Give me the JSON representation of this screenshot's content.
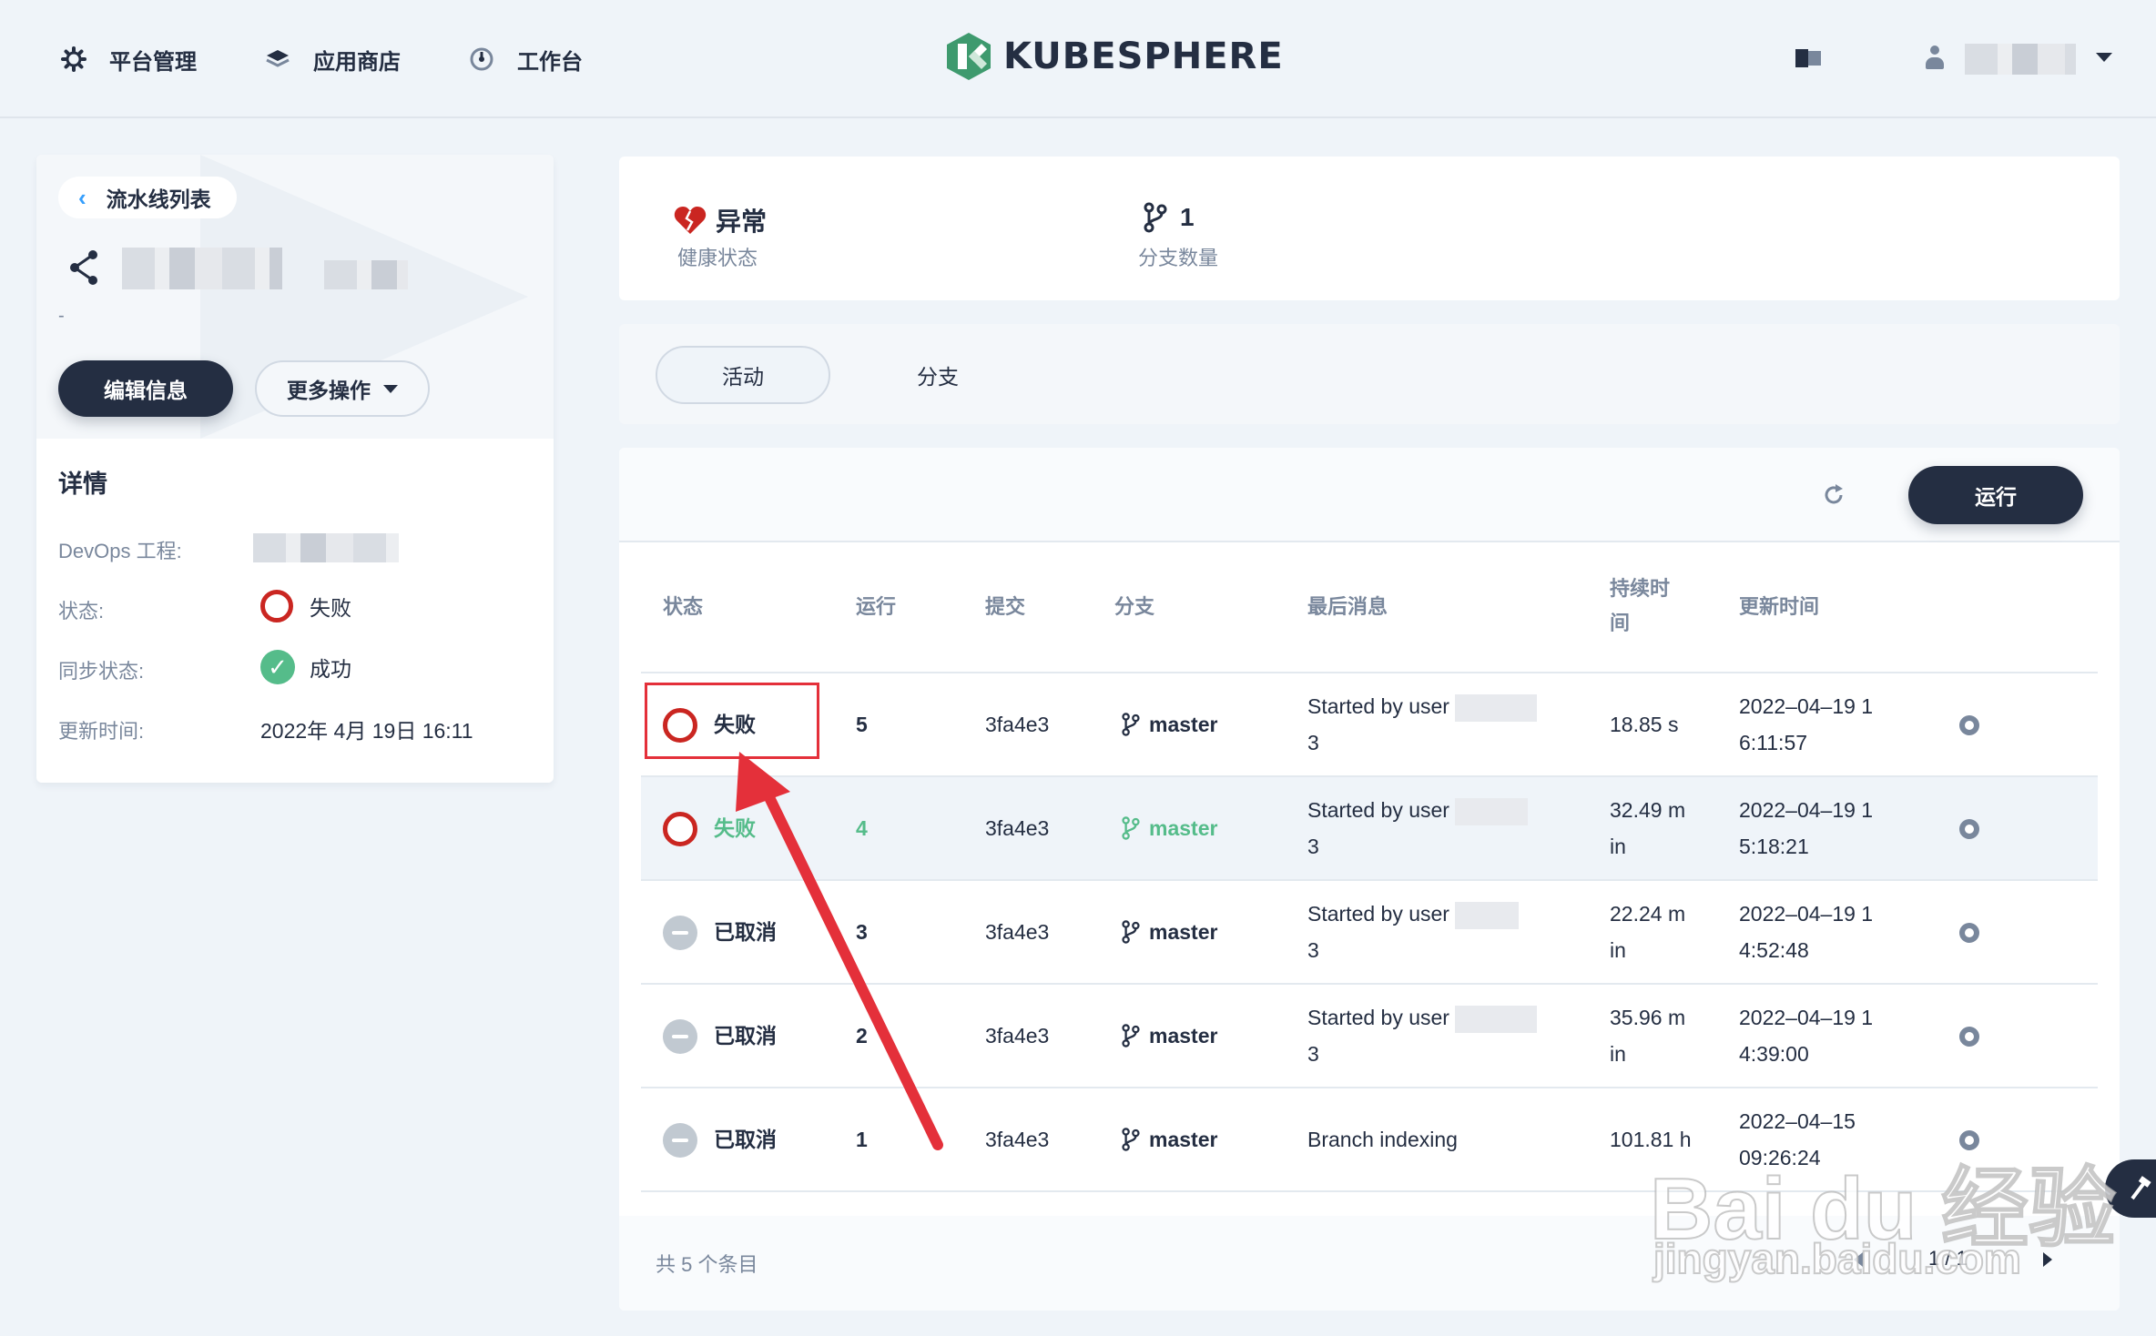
{
  "nav": {
    "items": [
      {
        "label": "平台管理",
        "icon": "gear-icon"
      },
      {
        "label": "应用商店",
        "icon": "layers-icon"
      },
      {
        "label": "工作台",
        "icon": "dashboard-icon"
      }
    ],
    "brand": "KUBESPHERE"
  },
  "sidebar": {
    "back_label": "流水线列表",
    "desc": "-",
    "edit_label": "编辑信息",
    "more_label": "更多操作",
    "details_title": "详情",
    "rows": [
      {
        "label": "DevOps 工程:",
        "value": ""
      },
      {
        "label": "状态:",
        "value": "失败"
      },
      {
        "label": "同步状态:",
        "value": "成功"
      },
      {
        "label": "更新时间:",
        "value": "2022年 4月 19日 16:11"
      }
    ]
  },
  "summary": {
    "health_value": "异常",
    "health_label": "健康状态",
    "branch_value": "1",
    "branch_label": "分支数量"
  },
  "tabs": {
    "activity": "活动",
    "branches": "分支"
  },
  "toolbar": {
    "run_label": "运行"
  },
  "table": {
    "headers": [
      "状态",
      "运行",
      "提交",
      "分支",
      "最后消息",
      "持续时\n间",
      "更新时间"
    ],
    "rows": [
      {
        "status": "失败",
        "run": "5",
        "commit": "3fa4e3",
        "branch": "master",
        "msg1": "Started by user",
        "msg2": "3",
        "duration1": "18.85 s",
        "duration2": "",
        "time1": "2022–04–19 1",
        "time2": "6:11:57"
      },
      {
        "status": "失败",
        "run": "4",
        "commit": "3fa4e3",
        "branch": "master",
        "msg1": "Started by user",
        "msg2": "3",
        "duration1": "32.49 m",
        "duration2": "in",
        "time1": "2022–04–19 1",
        "time2": "5:18:21"
      },
      {
        "status": "已取消",
        "run": "3",
        "commit": "3fa4e3",
        "branch": "master",
        "msg1": "Started by user",
        "msg2": "3",
        "duration1": "22.24 m",
        "duration2": "in",
        "time1": "2022–04–19 1",
        "time2": "4:52:48"
      },
      {
        "status": "已取消",
        "run": "2",
        "commit": "3fa4e3",
        "branch": "master",
        "msg1": "Started by user",
        "msg2": "3",
        "duration1": "35.96 m",
        "duration2": "in",
        "time1": "2022–04–19 1",
        "time2": "4:39:00"
      },
      {
        "status": "已取消",
        "run": "1",
        "commit": "3fa4e3",
        "branch": "master",
        "msg1": "Branch indexing",
        "msg2": "",
        "duration1": "101.81 h",
        "duration2": "",
        "time1": "2022–04–15",
        "time2": "09:26:24"
      }
    ],
    "total": "共 5 个条目",
    "pagination": "1 / 1"
  },
  "watermark": {
    "main": "Bai du 经验",
    "sub": "jingyan.baidu.com"
  },
  "colors": {
    "primary_dark": "#242e42",
    "fail_red": "#ca2621",
    "success_green": "#55bc8a",
    "annotation_red": "#e4303a"
  }
}
